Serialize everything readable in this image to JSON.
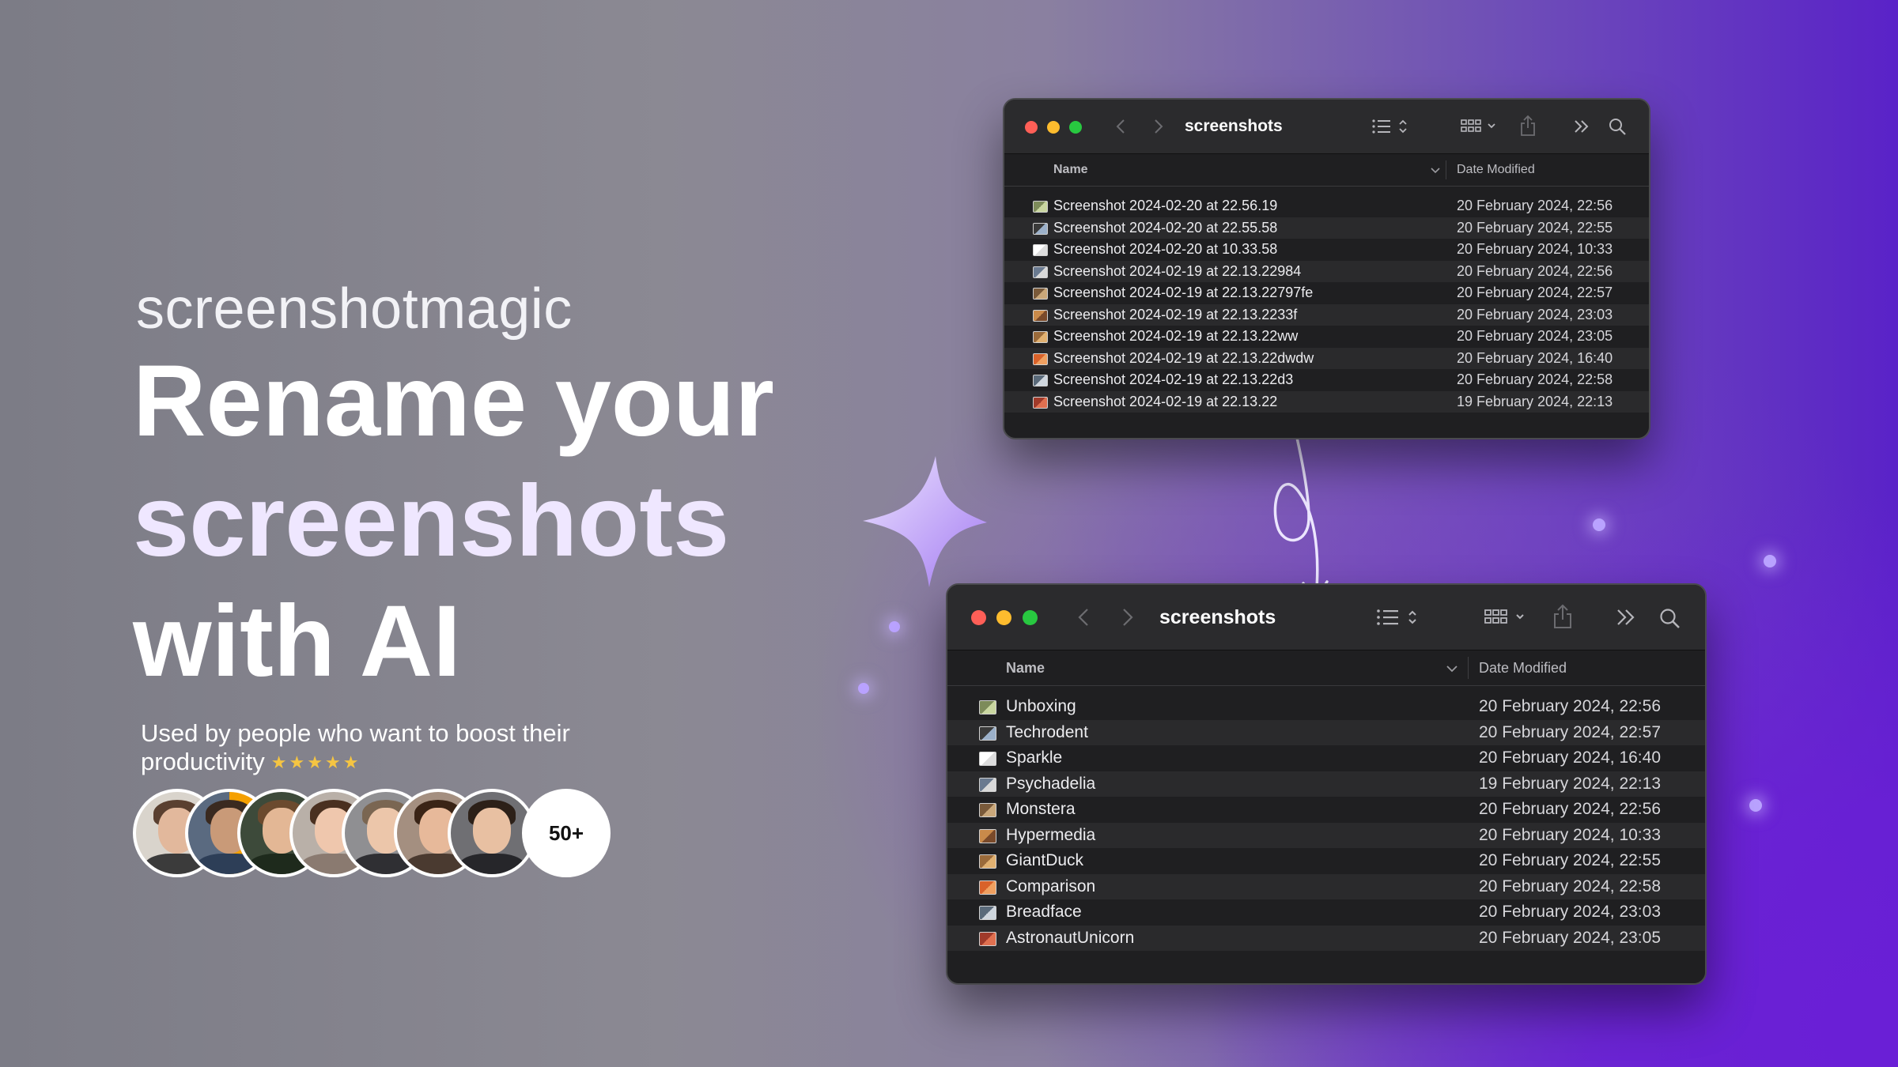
{
  "hero": {
    "brand": "screenshotmagic",
    "headline": [
      "Rename your",
      "screenshots",
      "with AI"
    ],
    "tagline": "Used by people who want to boost their productivity",
    "stars": "★★★★★",
    "more_count": "50+"
  },
  "colors": {
    "accent_purple": "#6a1fd6",
    "star_yellow": "#f5c542",
    "window_bg": "#1f1f21",
    "traffic_red": "#ff5f57",
    "traffic_yellow": "#febc2e",
    "traffic_green": "#28c840"
  },
  "before_window": {
    "title": "screenshots",
    "columns": {
      "name": "Name",
      "date": "Date Modified"
    },
    "files": [
      {
        "name": "Screenshot 2024-02-20 at 22.56.19",
        "date": "20 February 2024, 22:56",
        "icon": "image-thumbnail-icon"
      },
      {
        "name": "Screenshot 2024-02-20 at 22.55.58",
        "date": "20 February 2024, 22:55",
        "icon": "image-thumbnail-icon"
      },
      {
        "name": "Screenshot 2024-02-20 at 10.33.58",
        "date": "20 February 2024, 10:33",
        "icon": "image-thumbnail-icon"
      },
      {
        "name": "Screenshot 2024-02-19 at 22.13.22984",
        "date": "20 February 2024, 22:56",
        "icon": "image-thumbnail-icon"
      },
      {
        "name": "Screenshot 2024-02-19 at 22.13.22797fe",
        "date": "20 February 2024, 22:57",
        "icon": "image-thumbnail-icon"
      },
      {
        "name": "Screenshot 2024-02-19 at 22.13.2233f",
        "date": "20 February 2024, 23:03",
        "icon": "image-thumbnail-icon"
      },
      {
        "name": "Screenshot 2024-02-19 at 22.13.22ww",
        "date": "20 February 2024, 23:05",
        "icon": "image-thumbnail-icon"
      },
      {
        "name": "Screenshot 2024-02-19 at 22.13.22dwdw",
        "date": "20 February 2024, 16:40",
        "icon": "image-thumbnail-icon"
      },
      {
        "name": "Screenshot 2024-02-19 at 22.13.22d3",
        "date": "20 February 2024, 22:58",
        "icon": "image-thumbnail-icon"
      },
      {
        "name": "Screenshot 2024-02-19 at 22.13.22",
        "date": "19 February 2024, 22:13",
        "icon": "image-thumbnail-icon"
      }
    ]
  },
  "after_window": {
    "title": "screenshots",
    "columns": {
      "name": "Name",
      "date": "Date Modified"
    },
    "files": [
      {
        "name": "Unboxing",
        "date": "20 February 2024, 22:56",
        "icon": "image-thumbnail-icon"
      },
      {
        "name": "Techrodent",
        "date": "20 February 2024, 22:57",
        "icon": "image-thumbnail-icon"
      },
      {
        "name": "Sparkle",
        "date": "20 February 2024, 16:40",
        "icon": "image-thumbnail-icon"
      },
      {
        "name": "Psychadelia",
        "date": "19 February 2024, 22:13",
        "icon": "image-thumbnail-icon"
      },
      {
        "name": "Monstera",
        "date": "20 February 2024, 22:56",
        "icon": "image-thumbnail-icon"
      },
      {
        "name": "Hypermedia",
        "date": "20 February 2024, 10:33",
        "icon": "image-thumbnail-icon"
      },
      {
        "name": "GiantDuck",
        "date": "20 February 2024, 22:55",
        "icon": "image-thumbnail-icon"
      },
      {
        "name": "Comparison",
        "date": "20 February 2024, 22:58",
        "icon": "image-thumbnail-icon"
      },
      {
        "name": "Breadface",
        "date": "20 February 2024, 23:03",
        "icon": "image-thumbnail-icon"
      },
      {
        "name": "AstronautUnicorn",
        "date": "20 February 2024, 23:05",
        "icon": "image-thumbnail-icon"
      }
    ]
  }
}
